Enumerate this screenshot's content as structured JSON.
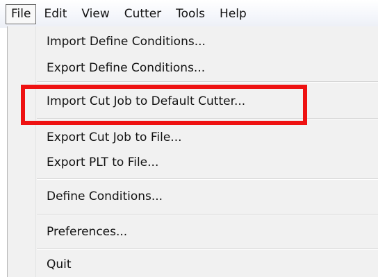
{
  "menubar": {
    "items": [
      {
        "label": "File"
      },
      {
        "label": "Edit"
      },
      {
        "label": "View"
      },
      {
        "label": "Cutter"
      },
      {
        "label": "Tools"
      },
      {
        "label": "Help"
      }
    ]
  },
  "file_menu": {
    "items": [
      {
        "label": "Import Define Conditions..."
      },
      {
        "label": "Export Define Conditions..."
      },
      {
        "label": "Import Cut Job to Default Cutter..."
      },
      {
        "label": "Export Cut Job to File..."
      },
      {
        "label": "Export PLT to File..."
      },
      {
        "label": "Define Conditions..."
      },
      {
        "label": "Preferences..."
      },
      {
        "label": "Quit"
      }
    ]
  },
  "annotation": {
    "highlight_color": "#ee1111"
  }
}
